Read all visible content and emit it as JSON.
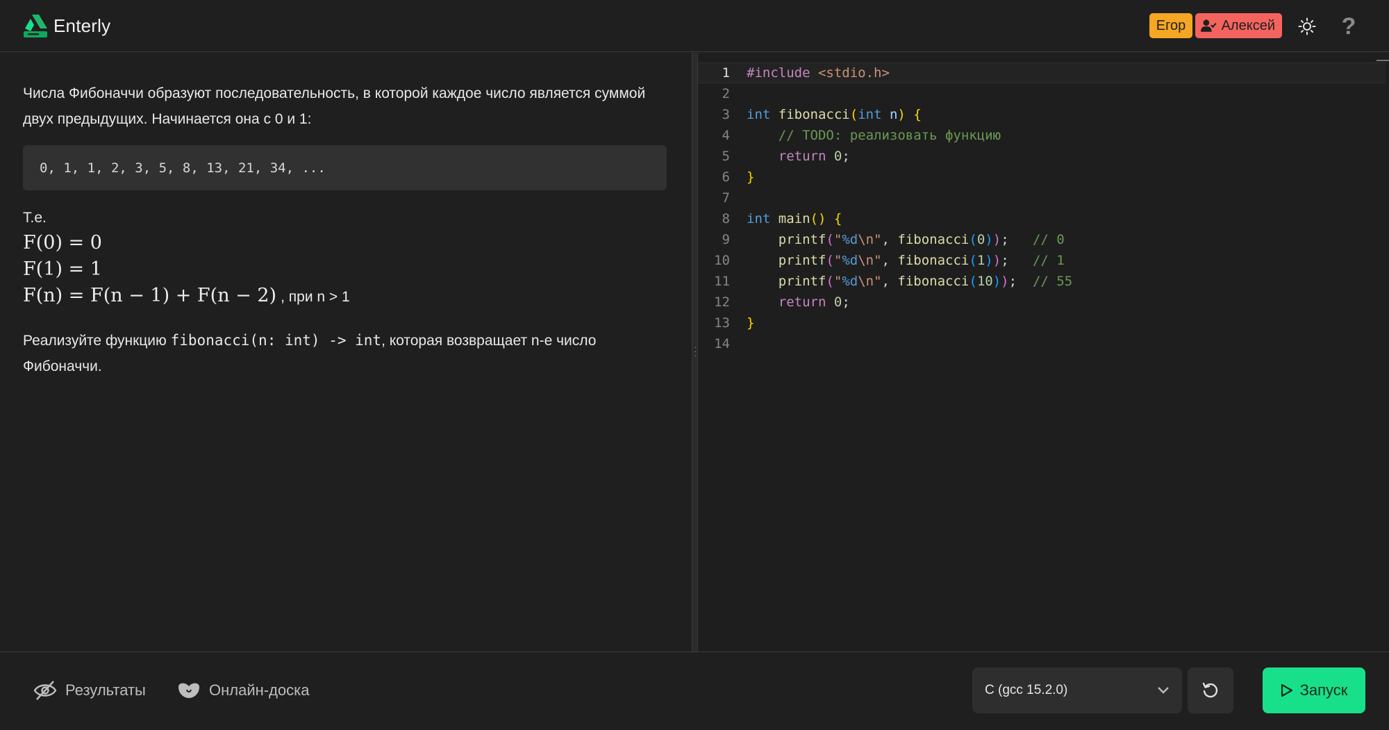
{
  "header": {
    "brand_name": "Enterly",
    "users": [
      "Егор",
      "Алексей"
    ],
    "help_label": "?"
  },
  "task": {
    "paragraph1": "Числа Фибоначчи образуют последовательность, в которой каждое число является суммой двух предыдущих. Начинается она с 0 и 1:",
    "sequence": "0, 1, 1, 2, 3, 5, 8, 13, 21, 34, ...",
    "te": "Т.е.",
    "formula1": "F(0) = 0",
    "formula2": "F(1) = 1",
    "formula3": "F(n) = F(n − 1) + F(n − 2)",
    "formula3_suffix": ", при n > 1",
    "p2_before": "Реализуйте функцию ",
    "p2_code": "fibonacci(n: int) -> int",
    "p2_after": ", которая возвращает n-е число Фибоначчи."
  },
  "editor": {
    "line_numbers": [
      "1",
      "2",
      "3",
      "4",
      "5",
      "6",
      "7",
      "8",
      "9",
      "10",
      "11",
      "12",
      "13",
      "14"
    ],
    "current_line": 1
  },
  "footer": {
    "results_label": "Результаты",
    "board_label": "Онлайн-доска",
    "language_selected": "C (gcc 15.2.0)",
    "run_label": "Запуск"
  },
  "colors": {
    "accent_green": "#18e08a",
    "badge_orange": "#f5a623",
    "badge_red": "#f4645f"
  }
}
